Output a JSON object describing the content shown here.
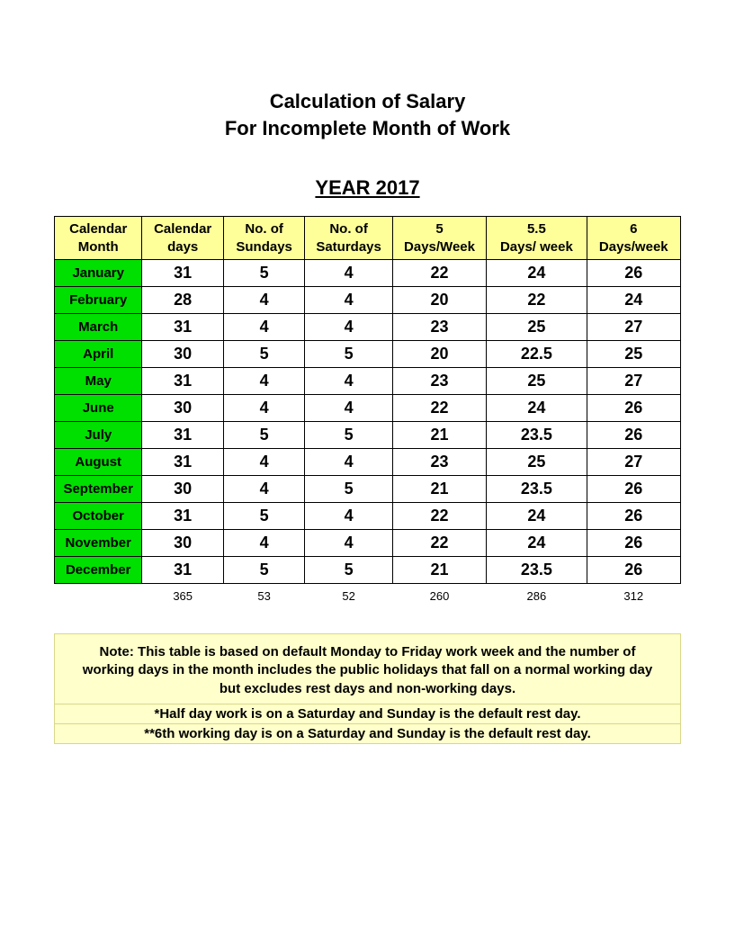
{
  "heading": {
    "line1": "Calculation of Salary",
    "line2": "For Incomplete Month of Work",
    "year": "YEAR 2017"
  },
  "columns": [
    {
      "l1": "Calendar",
      "l2": "Month"
    },
    {
      "l1": "Calendar",
      "l2": "days"
    },
    {
      "l1": "No. of",
      "l2": "Sundays"
    },
    {
      "l1": "No. of",
      "l2": "Saturdays"
    },
    {
      "l1": "5",
      "l2": "Days/Week"
    },
    {
      "l1": "5.5",
      "l2": "Days/ week"
    },
    {
      "l1": "6",
      "l2": "Days/week"
    }
  ],
  "rows": [
    {
      "month": "January",
      "days": "31",
      "sun": "5",
      "sat": "4",
      "d5": "22",
      "d55": "24",
      "d6": "26"
    },
    {
      "month": "February",
      "days": "28",
      "sun": "4",
      "sat": "4",
      "d5": "20",
      "d55": "22",
      "d6": "24"
    },
    {
      "month": "March",
      "days": "31",
      "sun": "4",
      "sat": "4",
      "d5": "23",
      "d55": "25",
      "d6": "27"
    },
    {
      "month": "April",
      "days": "30",
      "sun": "5",
      "sat": "5",
      "d5": "20",
      "d55": "22.5",
      "d6": "25"
    },
    {
      "month": "May",
      "days": "31",
      "sun": "4",
      "sat": "4",
      "d5": "23",
      "d55": "25",
      "d6": "27"
    },
    {
      "month": "June",
      "days": "30",
      "sun": "4",
      "sat": "4",
      "d5": "22",
      "d55": "24",
      "d6": "26"
    },
    {
      "month": "July",
      "days": "31",
      "sun": "5",
      "sat": "5",
      "d5": "21",
      "d55": "23.5",
      "d6": "26"
    },
    {
      "month": "August",
      "days": "31",
      "sun": "4",
      "sat": "4",
      "d5": "23",
      "d55": "25",
      "d6": "27"
    },
    {
      "month": "September",
      "days": "30",
      "sun": "4",
      "sat": "5",
      "d5": "21",
      "d55": "23.5",
      "d6": "26"
    },
    {
      "month": "October",
      "days": "31",
      "sun": "5",
      "sat": "4",
      "d5": "22",
      "d55": "24",
      "d6": "26"
    },
    {
      "month": "November",
      "days": "30",
      "sun": "4",
      "sat": "4",
      "d5": "22",
      "d55": "24",
      "d6": "26"
    },
    {
      "month": "December",
      "days": "31",
      "sun": "5",
      "sat": "5",
      "d5": "21",
      "d55": "23.5",
      "d6": "26"
    }
  ],
  "totals": {
    "days": "365",
    "sun": "53",
    "sat": "52",
    "d5": "260",
    "d55": "286",
    "d6": "312"
  },
  "note": {
    "main": "Note: This table is based on default Monday to Friday work week and the number of working days in the month includes the public holidays that fall on a normal working day but excludes rest days and non-working days.",
    "sub1": "*Half day work is on a Saturday and Sunday is the default rest day.",
    "sub2": "**6th working day is on a Saturday and Sunday is the default rest day."
  }
}
